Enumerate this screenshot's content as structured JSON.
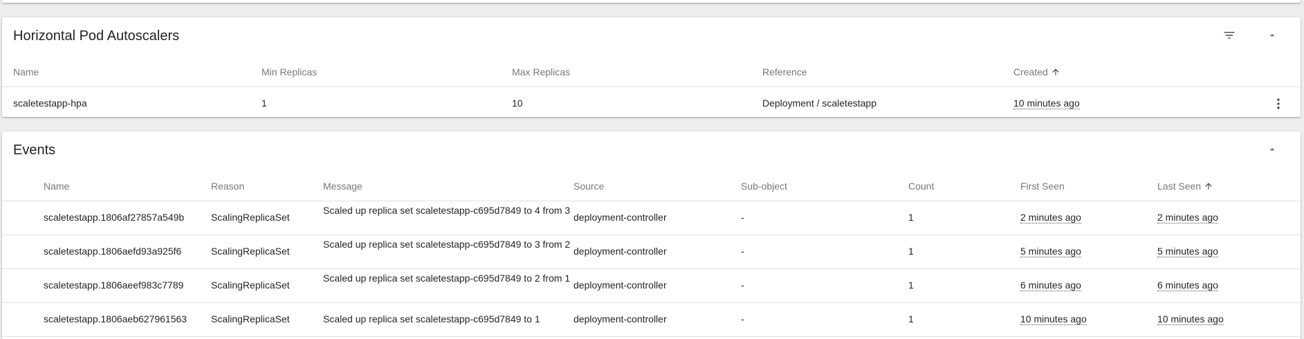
{
  "hpa": {
    "title": "Horizontal Pod Autoscalers",
    "columns": {
      "name": "Name",
      "min_replicas": "Min Replicas",
      "max_replicas": "Max Replicas",
      "reference": "Reference",
      "created": "Created"
    },
    "rows": [
      {
        "name": "scaletestapp-hpa",
        "min_replicas": "1",
        "max_replicas": "10",
        "reference": "Deployment / scaletestapp",
        "created": "10 minutes ago"
      }
    ]
  },
  "events": {
    "title": "Events",
    "columns": {
      "name": "Name",
      "reason": "Reason",
      "message": "Message",
      "source": "Source",
      "sub_object": "Sub-object",
      "count": "Count",
      "first_seen": "First Seen",
      "last_seen": "Last Seen"
    },
    "rows": [
      {
        "name": "scaletestapp.1806af27857a549b",
        "reason": "ScalingReplicaSet",
        "message": "Scaled up replica set scaletestapp-c695d7849 to 4 from 3",
        "source": "deployment-controller",
        "sub_object": "-",
        "count": "1",
        "first_seen": "2 minutes ago",
        "last_seen": "2 minutes ago"
      },
      {
        "name": "scaletestapp.1806aefd93a925f6",
        "reason": "ScalingReplicaSet",
        "message": "Scaled up replica set scaletestapp-c695d7849 to 3 from 2",
        "source": "deployment-controller",
        "sub_object": "-",
        "count": "1",
        "first_seen": "5 minutes ago",
        "last_seen": "5 minutes ago"
      },
      {
        "name": "scaletestapp.1806aeef983c7789",
        "reason": "ScalingReplicaSet",
        "message": "Scaled up replica set scaletestapp-c695d7849 to 2 from 1",
        "source": "deployment-controller",
        "sub_object": "-",
        "count": "1",
        "first_seen": "6 minutes ago",
        "last_seen": "6 minutes ago"
      },
      {
        "name": "scaletestapp.1806aeb627961563",
        "reason": "ScalingReplicaSet",
        "message": "Scaled up replica set scaletestapp-c695d7849 to 1",
        "source": "deployment-controller",
        "sub_object": "-",
        "count": "1",
        "first_seen": "10 minutes ago",
        "last_seen": "10 minutes ago"
      }
    ]
  },
  "icons": {
    "filter": "filter-icon",
    "collapse": "chevron-up-icon",
    "sort": "arrow-up-icon",
    "more": "more-vert-icon"
  }
}
